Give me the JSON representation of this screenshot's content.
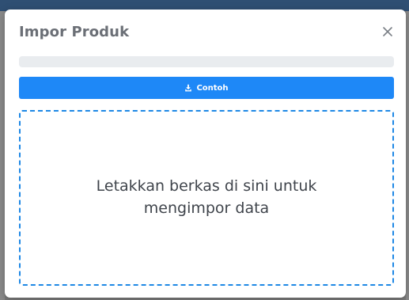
{
  "modal": {
    "title": "Impor Produk",
    "close_icon": "close-icon",
    "progress": {
      "value_percent": 0
    },
    "sample_button": {
      "icon": "download-icon",
      "label": "Contoh"
    },
    "dropzone": {
      "text": "Letakkan berkas di sini untuk mengimpor data"
    }
  },
  "colors": {
    "accent": "#1E88F7",
    "dropzone_border": "#1E88E5",
    "title_text": "#6B6F76",
    "body_text": "#3F444B"
  }
}
